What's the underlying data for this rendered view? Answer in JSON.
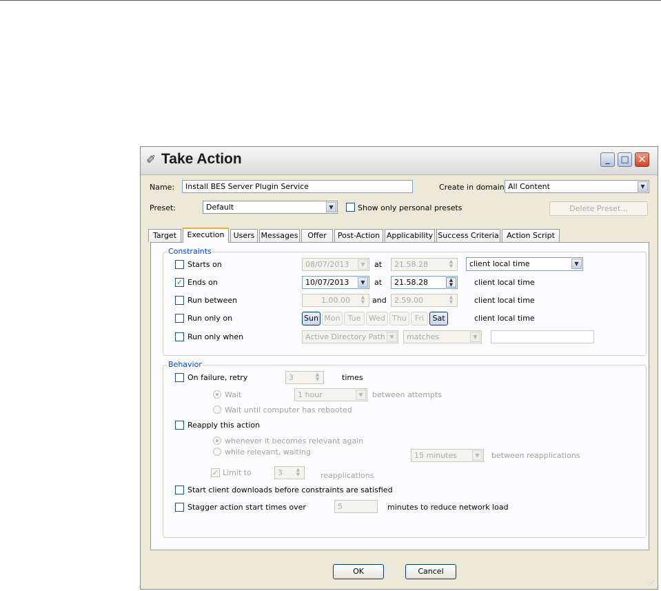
{
  "window": {
    "title": "Take Action"
  },
  "header": {
    "name_label": "Name:",
    "name_value": "Install BES Server Plugin Service",
    "domain_label": "Create in domain:",
    "domain_value": "All Content",
    "preset_label": "Preset:",
    "preset_value": "Default",
    "personal_presets_label": "Show only personal presets",
    "delete_preset_label": "Delete Preset..."
  },
  "tabs": [
    {
      "label": "Target"
    },
    {
      "label": "Execution"
    },
    {
      "label": "Users"
    },
    {
      "label": "Messages"
    },
    {
      "label": "Offer"
    },
    {
      "label": "Post-Action"
    },
    {
      "label": "Applicability"
    },
    {
      "label": "Success Criteria"
    },
    {
      "label": "Action Script"
    }
  ],
  "active_tab": "Execution",
  "constraints": {
    "title": "Constraints",
    "starts_on": {
      "label": "Starts on",
      "checked": false,
      "date": "08/07/2013",
      "at": "at",
      "time": "21.58.28",
      "tz": "client local time"
    },
    "ends_on": {
      "label": "Ends on",
      "checked": true,
      "date": "10/07/2013",
      "at": "at",
      "time": "21.58.28",
      "tz": "client local time"
    },
    "run_between": {
      "label": "Run between",
      "checked": false,
      "from": "1.00.00",
      "and": "and",
      "to": "2.59.00",
      "tz": "client local time"
    },
    "run_only_on": {
      "label": "Run only on",
      "checked": false,
      "days": [
        "Sun",
        "Mon",
        "Tue",
        "Wed",
        "Thu",
        "Fri",
        "Sat"
      ],
      "tz": "client local time"
    },
    "run_only_when": {
      "label": "Run only when",
      "checked": false,
      "property": "Active Directory Path",
      "operator": "matches",
      "value": ""
    }
  },
  "behavior": {
    "title": "Behavior",
    "on_failure": {
      "label": "On failure, retry",
      "count": "3",
      "times": "times"
    },
    "wait": {
      "label": "Wait",
      "value": "1 hour",
      "suffix": "between attempts"
    },
    "wait_reboot": {
      "label": "Wait until computer has rebooted"
    },
    "reapply": {
      "label": "Reapply this action"
    },
    "whenever": {
      "label": "whenever it becomes relevant again"
    },
    "while_relevant": {
      "label": "while relevant, waiting",
      "value": "15 minutes",
      "suffix": "between reapplications"
    },
    "limit": {
      "label": "Limit to",
      "count": "3",
      "suffix": "reapplications"
    },
    "start_downloads": {
      "label": "Start client downloads before constraints are satisfied"
    },
    "stagger": {
      "label": "Stagger action start times over",
      "value": "5",
      "suffix": "minutes to reduce network load"
    }
  },
  "footer": {
    "ok_label": "OK",
    "cancel_label": "Cancel"
  }
}
